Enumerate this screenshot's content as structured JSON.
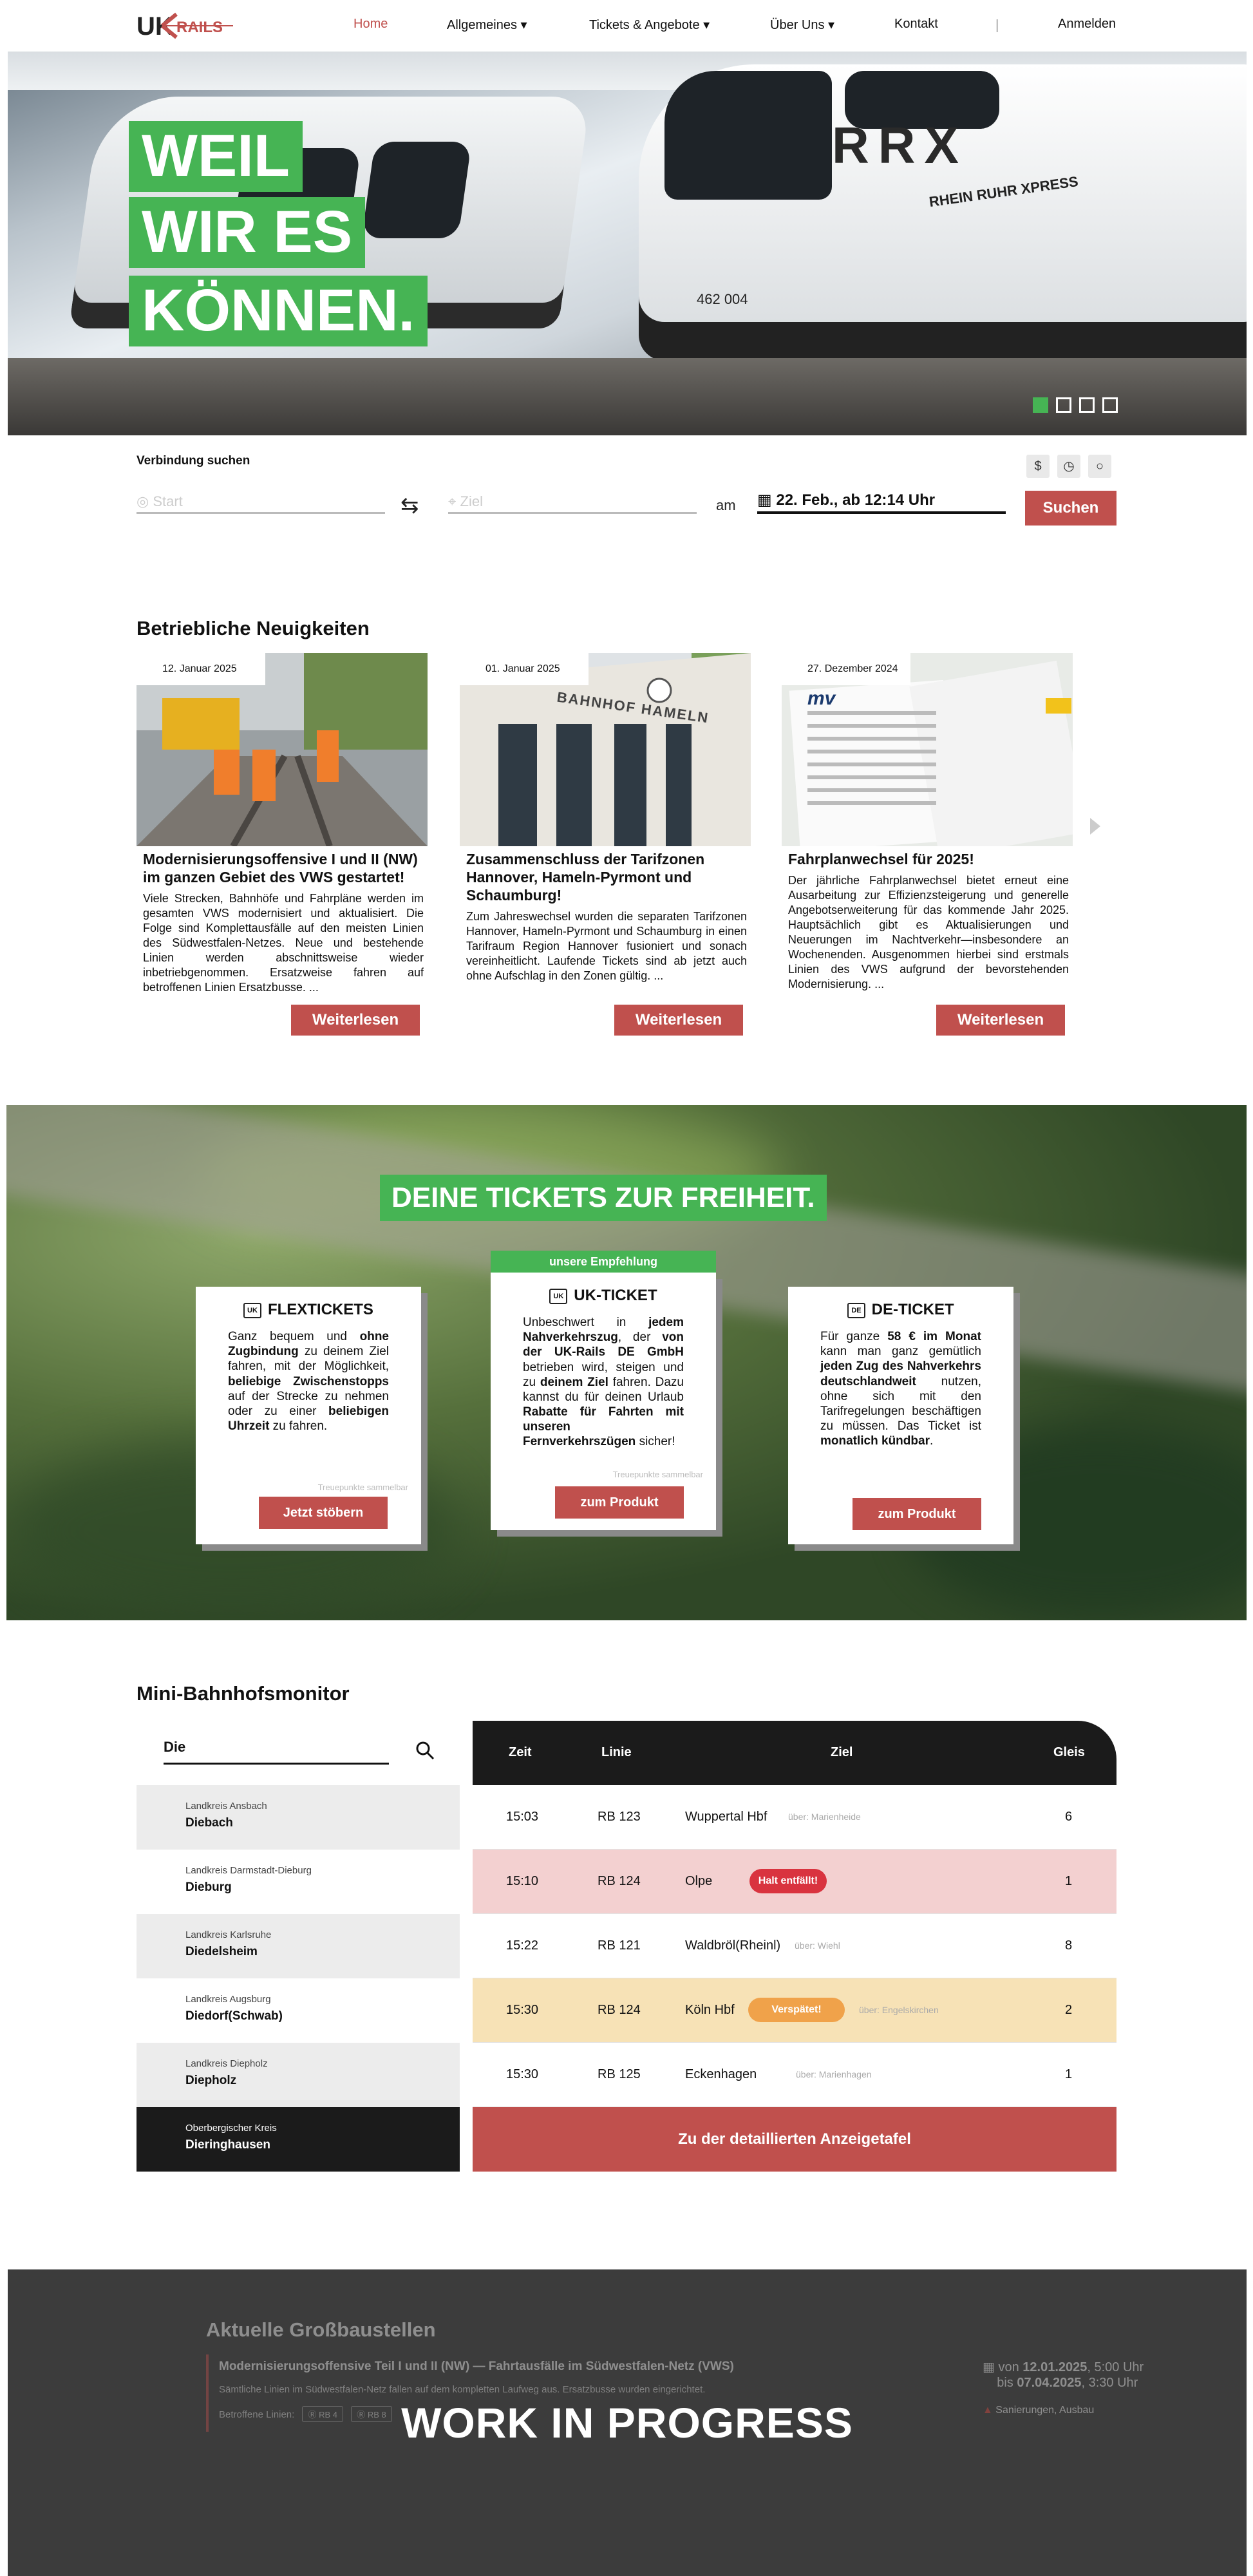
{
  "nav": {
    "logo_text_uk": "UK",
    "logo_text_rails": "RAILS",
    "items": [
      {
        "label": "Home"
      },
      {
        "label": "Allgemeines ▾"
      },
      {
        "label": "Tickets & Angebote ▾"
      },
      {
        "label": "Über Uns ▾"
      },
      {
        "label": "Kontakt"
      }
    ],
    "login": "Anmelden"
  },
  "hero": {
    "lines": [
      "WEIL",
      "WIR ES",
      "KÖNNEN."
    ],
    "train_brand": "RRX",
    "train_brand_sub": "RHEIN RUHR XPRESS",
    "train_number": "462 004",
    "slides": 4,
    "active_slide": 1
  },
  "search": {
    "title": "Verbindung suchen",
    "start_placeholder": "Start",
    "ziel_placeholder": "Ziel",
    "am_label": "am",
    "date_value": "22. Feb., ab 12:14 Uhr",
    "submit_label": "Suchen",
    "icons": [
      "dollar-icon",
      "clock-icon",
      "circle-icon"
    ]
  },
  "news": {
    "title": "Betriebliche Neuigkeiten",
    "more_label": "Weiterlesen",
    "items": [
      {
        "date": "12. Januar 2025",
        "headline": "Modernisierungsoffensive I und II (NW) im ganzen Gebiet des VWS gestartet!",
        "text": "Viele Strecken, Bahnhöfe und Fahrpläne werden im gesamten VWS modernisiert und aktualisiert. Die Folge sind Komplettausfälle auf den meisten Linien des Südwestfalen-Netzes. Neue und bestehende Linien werden abschnittsweise wieder inbetriebgenommen. Ersatzweise fahren auf betroffenen Linien Ersatzbusse. ..."
      },
      {
        "date": "01. Januar 2025",
        "headline": "Zusammenschluss der Tarifzonen Hannover, Hameln-Pyrmont und Schaumburg!",
        "text": "Zum Jahreswechsel wurden die separaten Tarifzonen Hannover, Hameln-Pyrmont und Schaumburg in einen Tarifraum Region Hannover fusioniert und sonach vereinheitlicht. Laufende Tickets sind ab jetzt auch ohne Aufschlag in den Zonen gültig. ...",
        "img_label": "BAHNHOF HAMELN"
      },
      {
        "date": "27. Dezember 2024",
        "headline": "Fahrplanwechsel für 2025!",
        "text": "Der jährliche Fahrplanwechsel bietet erneut eine Ausarbeitung zur Effizienzsteigerung und generelle Angebotserweiterung für das kommende Jahr 2025. Hauptsächlich gibt es Aktualisierungen und Neuerungen im Nachtverkehr—insbesondere an Wochenenden. Ausgenommen hierbei sind erstmals Linien des VWS aufgrund der bevorstehenden Modernisierung. ..."
      }
    ]
  },
  "tickets": {
    "headline": "DEINE TICKETS ZUR FREIHEIT.",
    "badge": "unsere Empfehlung",
    "cards": [
      {
        "icon_text": "UK",
        "title": "FLEXTICKETS",
        "body_html": "Ganz bequem und <b>ohne Zugbindung</b> zu deinem Ziel fahren, mit der Möglichkeit, <b>beliebige Zwischenstopps</b> auf der Strecke zu nehmen oder zu einer <b>beliebigen Uhrzeit</b> zu fahren.",
        "note": "Treuepunkte sammelbar",
        "button": "Jetzt stöbern"
      },
      {
        "icon_text": "UK",
        "title": "UK-TICKET",
        "body_html": "Unbeschwert in <b>jedem Nahverkehrszug</b>, der <b>von der UK-Rails DE GmbH</b> betrieben wird, steigen und zu <b>deinem Ziel</b> fahren. Dazu kannst du für deinen Urlaub <b>Rabatte für Fahrten mit unseren Fernverkehrszügen</b> sicher!",
        "note": "Treuepunkte sammelbar",
        "button": "zum Produkt"
      },
      {
        "icon_text": "DE",
        "title": "DE-TICKET",
        "body_html": "Für ganze <b>58 € im Monat</b> kann man ganz gemütlich <b>jeden Zug des Nahverkehrs deutschlandweit</b> nutzen, ohne sich mit den Tarifregelungen beschäftigen zu müssen. Das Ticket ist <b>monatlich kündbar</b>.",
        "note": "",
        "button": "zum Produkt"
      }
    ]
  },
  "monitor": {
    "title": "Mini-Bahnhofsmonitor",
    "search_value": "Die",
    "stations": [
      {
        "region": "Landkreis Ansbach",
        "name": "Diebach"
      },
      {
        "region": "Landkreis Darmstadt-Dieburg",
        "name": "Dieburg"
      },
      {
        "region": "Landkreis Karlsruhe",
        "name": "Diedelsheim"
      },
      {
        "region": "Landkreis Augsburg",
        "name": "Diedorf(Schwab)"
      },
      {
        "region": "Landkreis Diepholz",
        "name": "Diepholz"
      },
      {
        "region": "Oberbergischer Kreis",
        "name": "Dieringhausen"
      }
    ],
    "headers": {
      "zeit": "Zeit",
      "linie": "Linie",
      "ziel": "Ziel",
      "gleis": "Gleis"
    },
    "departures": [
      {
        "zeit": "15:03",
        "linie": "RB 123",
        "ziel": "Wuppertal Hbf",
        "via": "über: Marienheide",
        "gleis": "6",
        "status": "",
        "bg": "#ffffff"
      },
      {
        "zeit": "15:10",
        "linie": "RB 124",
        "ziel": "Olpe",
        "via": "",
        "gleis": "1",
        "status": "Halt entfällt!",
        "status_color": "#d9333f",
        "bg": "#f3d0d0"
      },
      {
        "zeit": "15:22",
        "linie": "RB 121",
        "ziel": "Waldbröl(Rheinl)",
        "via": "über: Wiehl",
        "gleis": "8",
        "status": "",
        "bg": "#ffffff"
      },
      {
        "zeit": "15:30",
        "linie": "RB 124",
        "ziel": "Köln Hbf",
        "via": "über: Engelskirchen",
        "gleis": "2",
        "status": "Verspätet!",
        "status_color": "#f0a24a",
        "bg": "#f7e2b6"
      },
      {
        "zeit": "15:30",
        "linie": "RB 125",
        "ziel": "Eckenhagen",
        "via": "über: Marienhagen",
        "gleis": "1",
        "status": "",
        "bg": "#ffffff"
      }
    ],
    "button": "Zu der detaillierten Anzeigetafel"
  },
  "wip": {
    "title": "Aktuelle Großbaustellen",
    "headline": "Modernisierungsoffensive Teil I und II (NW) — Fahrtausfälle im Südwestfalen-Netz (VWS)",
    "text": "Sämtliche Linien im Südwestfalen-Netz fallen auf dem kompletten Laufweg aus. Ersatzbusse wurden eingerichtet.",
    "lines_label": "Betroffene Linien:",
    "lines": [
      "RB 4",
      "RB 8"
    ],
    "date_from_prefix": "von",
    "date_from": "12.01.2025",
    "date_from_time": ", 5:00 Uhr",
    "date_to_prefix": "bis",
    "date_to": "07.04.2025",
    "date_to_time": ", 3:30 Uhr",
    "type": "Sanierungen, Ausbau",
    "overlay": "WORK IN PROGRESS"
  },
  "colors": {
    "accent_red": "#c0504d",
    "accent_green": "#46b454",
    "dark": "#1b1b1b"
  }
}
